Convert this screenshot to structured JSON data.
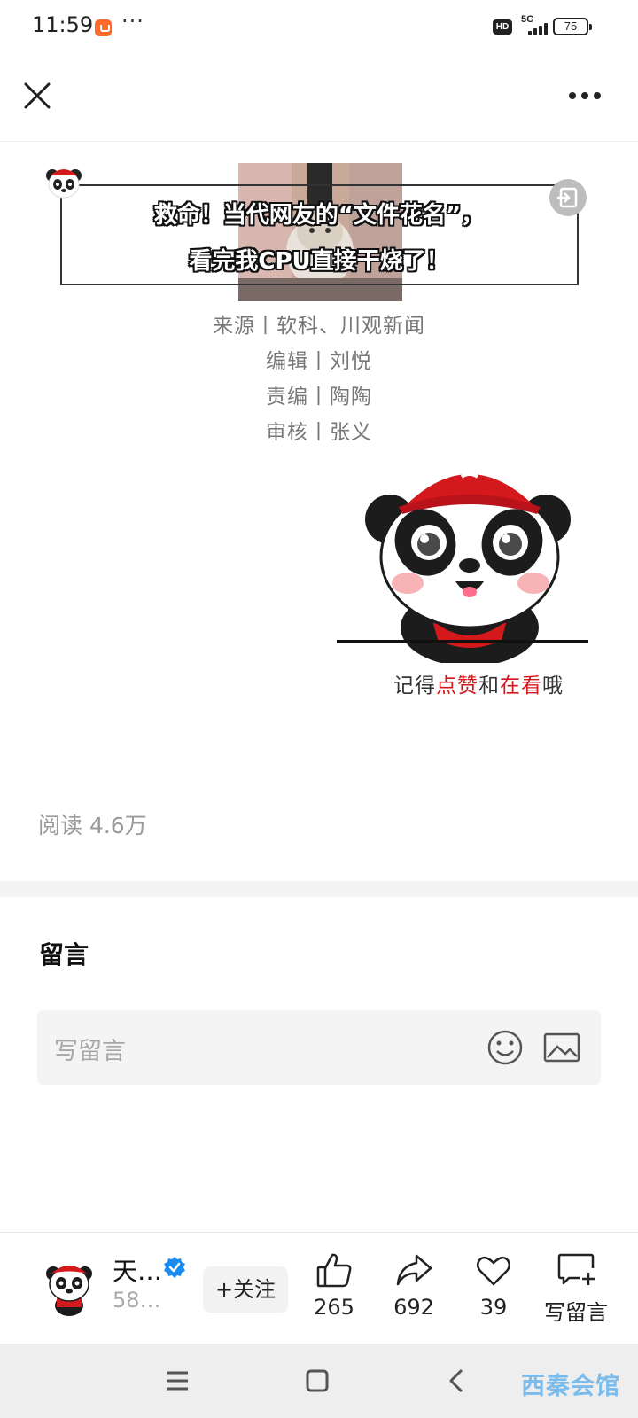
{
  "status_bar": {
    "time": "11:59",
    "more_dots": "···",
    "hd": "HD",
    "network": "5G",
    "battery": "75"
  },
  "article": {
    "banner": {
      "line1": "救命！当代网友的“文件花名”，",
      "line2": "看完我CPU直接干烧了！"
    },
    "credits": [
      "来源丨软科、川观新闻",
      "编辑丨刘悦",
      "责编丨陶陶",
      "审核丨张义"
    ],
    "illustration_caption": {
      "part1": "记得",
      "part2": "点赞",
      "part3": "和",
      "part4": "在看",
      "part5": "哦"
    },
    "read_count": "阅读 4.6万"
  },
  "comments": {
    "title": "留言",
    "placeholder": "写留言"
  },
  "bottom_bar": {
    "author_name": "天…",
    "author_followers": "58…",
    "follow_label": "+关注",
    "like_count": "265",
    "share_count": "692",
    "favorite_count": "39",
    "write_comment_label": "写留言"
  },
  "watermark": "西秦会馆",
  "colors": {
    "accent_red": "#d4191c",
    "verified_blue": "#1a8cf0",
    "app_badge": "#ff6a2a"
  }
}
